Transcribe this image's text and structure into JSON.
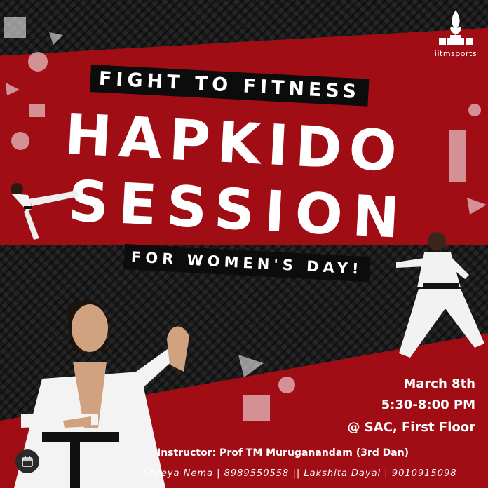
{
  "logo": {
    "text": "iitmsports",
    "icon": "flame-cup-icon"
  },
  "poster": {
    "tagline": "FIGHT TO FITNESS",
    "title_line1": "HAPKIDO",
    "title_line2": "SESSION",
    "subtitle": "FOR WOMEN'S DAY!",
    "date": "March 8th",
    "time": "5:30-8:00 PM",
    "venue": "@ SAC, First Floor",
    "instructor": "Instructor: Prof TM Muruganandam (3rd Dan)",
    "contacts": "Shreya Nema | 8989550558 || Lakshita Dayal | 9010915098"
  },
  "colors": {
    "red": "#a00d14",
    "dark": "#1d1d1d",
    "text": "#ffffff"
  },
  "overlay_button": {
    "icon": "calendar-icon"
  }
}
